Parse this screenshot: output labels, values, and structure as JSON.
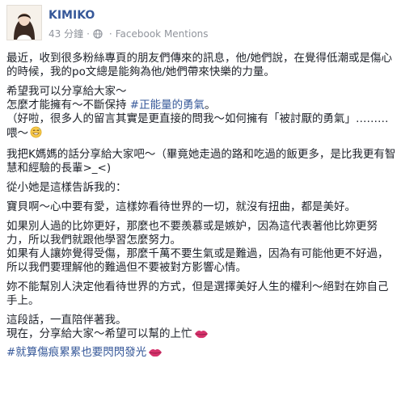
{
  "post": {
    "author": "KIMIKO",
    "time": "43 分鐘",
    "separator": "·",
    "source": "Facebook Mentions",
    "paragraphs": [
      [
        "最近，收到很多粉絲專頁的朋友們傳來的訊息，他/她們說，在覺得低潮或是傷心的時候，我的po文總是能夠為他/她們帶來快樂的力量。"
      ],
      [
        "希望我可以分享給大家～"
      ],
      [
        "怎麼才能擁有～不斷保持 "
      ],
      [
        "（好啦，很多人的留言其實是更直接的問我～如何擁有「被討厭的勇氣」………喂～"
      ],
      [
        "我把K媽媽的話分享給大家吧～（畢竟她走過的路和吃過的飯更多，是比我更有智慧和經驗的長輩>_<)"
      ],
      [
        "從小她是這樣告訴我的："
      ],
      [
        "寶貝啊～心中要有愛，這樣妳看待世界的一切，就沒有扭曲，都是美好。"
      ],
      [
        "如果別人過的比妳更好，那麼也不要羨慕或是嫉妒，因為這代表著他比妳更努力，所以我們就跟他學習怎麼努力。"
      ],
      [
        "如果有人讓妳覺得受傷，那麼千萬不要生氣或是難過，因為有可能他更不好過，所以我們要理解他的難過但不要被對方影響心情。"
      ],
      [
        "妳不能幫別人決定他看待世界的方式，但是選擇美好人生的權利～絕對在妳自己手上。"
      ],
      [
        "這段話，一直陪伴著我。"
      ],
      [
        "現在，分享給大家～希望可以幫的上忙"
      ]
    ],
    "hashtag_positive": "#正能量的勇氣",
    "hashtag_positive_tail": "。",
    "closing_hashtag": "#就算傷痕累累也要閃閃發光"
  },
  "icons": {
    "globe": "globe-icon",
    "lips": "lips-icon",
    "grin": "grin-sweat-emoji"
  },
  "colors": {
    "link": "#365899",
    "text": "#1d2129",
    "meta": "#90949c",
    "lips": "#d6336c"
  }
}
